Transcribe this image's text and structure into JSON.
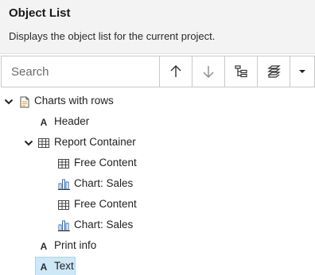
{
  "panel": {
    "title": "Object List",
    "subtitle": "Displays the object list for the current project."
  },
  "toolbar": {
    "search_placeholder": "Search",
    "buttons": [
      {
        "icon": "arrow-up-icon"
      },
      {
        "icon": "arrow-down-icon"
      },
      {
        "icon": "tree-view-icon"
      },
      {
        "icon": "layers-icon"
      },
      {
        "icon": "dropdown-caret-icon"
      }
    ]
  },
  "tree": {
    "items": [
      {
        "label": "Charts with rows",
        "icon": "document-icon",
        "expanded": true
      },
      {
        "label": "Header",
        "icon": "text-icon"
      },
      {
        "label": "Report Container",
        "icon": "table-icon",
        "expanded": true
      },
      {
        "label": "Free Content",
        "icon": "table-icon"
      },
      {
        "label": "Chart: Sales",
        "icon": "bar-chart-icon"
      },
      {
        "label": "Free Content",
        "icon": "table-icon"
      },
      {
        "label": "Chart: Sales",
        "icon": "bar-chart-icon"
      },
      {
        "label": "Print info",
        "icon": "text-icon"
      },
      {
        "label": "Text",
        "icon": "text-icon",
        "selected": true
      }
    ]
  },
  "colors": {
    "selection": "#cde8f7",
    "selection_border": "#a9d4ef",
    "header_bg": "#f3f3f3"
  }
}
